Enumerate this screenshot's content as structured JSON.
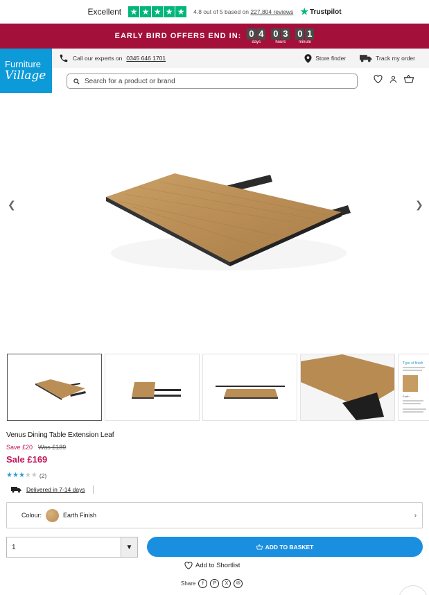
{
  "trustpilot": {
    "excellent": "Excellent",
    "rating_prefix": "4.8 out of 5 based on",
    "review_count": "227,804 reviews",
    "brand": "Trustpilot"
  },
  "promo": {
    "text": "EARLY BIRD OFFERS END IN:",
    "countdown": [
      {
        "d1": "0",
        "d2": "4",
        "label": "days"
      },
      {
        "d1": "0",
        "d2": "3",
        "label": "hours"
      },
      {
        "d1": "0",
        "d2": "1",
        "label": "minute"
      }
    ]
  },
  "header": {
    "logo_line1": "Furniture",
    "logo_line2": "Village",
    "call_text": "Call our experts on",
    "phone": "0345 646 1701",
    "store_finder": "Store finder",
    "track_order": "Track my order",
    "search_placeholder": "Search for a product or brand"
  },
  "product": {
    "title": "Venus Dining Table Extension Leaf",
    "save": "Save £20",
    "was": "Was £189",
    "sale": "Sale £169",
    "rating": 3,
    "rating_max": 5,
    "review_count": "(2)",
    "delivery": "Delivered in 7-14 days",
    "colour_label": "Colour:",
    "colour_value": "Earth Finish",
    "quantity": "1",
    "add_to_basket": "ADD TO BASKET",
    "shortlist": "Add to Shortlist",
    "share_label": "Share"
  },
  "thumbnail_panel_text": {
    "heading": "Type of finish",
    "caption": "Earth"
  },
  "colors": {
    "promo": "#a3103a",
    "trustpilot_green": "#00b67a",
    "logo_blue": "#0d9ad8",
    "basket_blue": "#1a8fe0",
    "sale_pink": "#c2185b"
  }
}
